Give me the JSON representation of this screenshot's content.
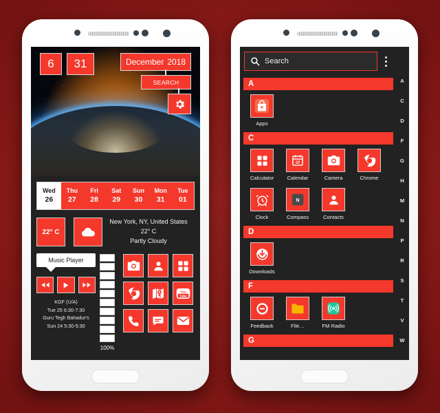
{
  "theme": {
    "accent": "#f4382c",
    "screen_bg": "#222222",
    "page_bg": "#8c1b18"
  },
  "left_phone": {
    "clock": {
      "hour": "6",
      "minute": "31"
    },
    "date_widget": {
      "month": "December",
      "year": "2018"
    },
    "search_button": "SEARCH",
    "settings_icon": "gear-icon",
    "week": [
      {
        "name": "Wed",
        "day": "26",
        "today": true
      },
      {
        "name": "Thu",
        "day": "27",
        "today": false
      },
      {
        "name": "Fri",
        "day": "28",
        "today": false
      },
      {
        "name": "Sat",
        "day": "29",
        "today": false
      },
      {
        "name": "Sun",
        "day": "30",
        "today": false
      },
      {
        "name": "Mon",
        "day": "31",
        "today": false
      },
      {
        "name": "Tue",
        "day": "01",
        "today": false
      }
    ],
    "weather": {
      "temp_badge": "22° C",
      "condition_icon": "cloud-icon",
      "location": "New York, NY, United States",
      "temperature": "22° C",
      "condition": "Partly Cloudy"
    },
    "music": {
      "title": "Music Player",
      "prev_icon": "rewind-icon",
      "play_icon": "play-icon",
      "next_icon": "fast-forward-icon"
    },
    "events": [
      "KGF (U/A)",
      "Tue 25 6:30-7:30",
      "Guru Tegh Bahadur's",
      "Sun 24 5:30-5:30"
    ],
    "battery": {
      "percent_label": "100%",
      "segments": 10,
      "filled": 10
    },
    "shortcuts": [
      {
        "name": "camera-icon"
      },
      {
        "name": "contacts-icon"
      },
      {
        "name": "apps-grid-icon"
      },
      {
        "name": "chrome-icon"
      },
      {
        "name": "maps-icon"
      },
      {
        "name": "youtube-icon"
      },
      {
        "name": "phone-icon"
      },
      {
        "name": "messages-icon"
      },
      {
        "name": "email-icon"
      }
    ]
  },
  "right_phone": {
    "search": {
      "placeholder": "Search",
      "icon": "search-icon"
    },
    "overflow_icon": "more-vertical-icon",
    "sections": [
      {
        "letter": "A",
        "apps": [
          {
            "label": "Apps",
            "icon": "apps-store-icon"
          }
        ]
      },
      {
        "letter": "C",
        "apps": [
          {
            "label": "Calculator",
            "icon": "calculator-icon"
          },
          {
            "label": "Calendar",
            "icon": "calendar-icon"
          },
          {
            "label": "Camera",
            "icon": "camera-icon"
          },
          {
            "label": "Chrome",
            "icon": "chrome-icon"
          },
          {
            "label": "Clock",
            "icon": "alarm-clock-icon"
          },
          {
            "label": "Compass",
            "icon": "compass-icon"
          },
          {
            "label": "Contacts",
            "icon": "contacts-icon"
          }
        ]
      },
      {
        "letter": "D",
        "apps": [
          {
            "label": "Downloads",
            "icon": "downloads-icon"
          }
        ]
      },
      {
        "letter": "F",
        "apps": [
          {
            "label": "Feedback",
            "icon": "feedback-icon"
          },
          {
            "label": "File…",
            "icon": "folder-icon"
          },
          {
            "label": "FM Radio",
            "icon": "fm-radio-icon"
          }
        ]
      },
      {
        "letter": "G",
        "apps": []
      }
    ],
    "index_letters": [
      "A",
      "C",
      "D",
      "F",
      "G",
      "H",
      "M",
      "N",
      "P",
      "R",
      "S",
      "T",
      "V",
      "W"
    ]
  }
}
